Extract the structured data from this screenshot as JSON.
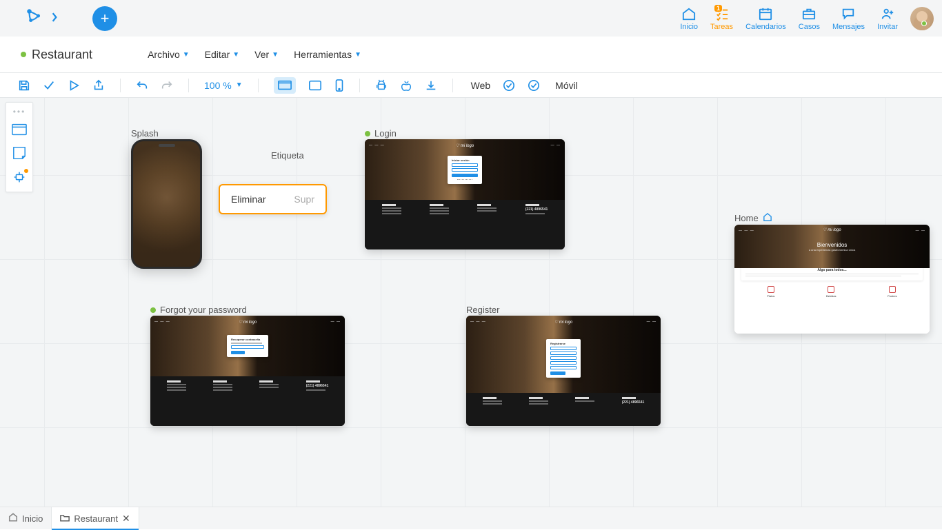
{
  "nav": {
    "inicio": "Inicio",
    "tareas": "Tareas",
    "tareas_badge": "1",
    "calendarios": "Calendarios",
    "casos": "Casos",
    "mensajes": "Mensajes",
    "invitar": "Invitar"
  },
  "doc": {
    "title": "Restaurant"
  },
  "menu": {
    "archivo": "Archivo",
    "editar": "Editar",
    "ver": "Ver",
    "herramientas": "Herramientas"
  },
  "toolbar": {
    "zoom": "100 %",
    "web": "Web",
    "movil": "Móvil"
  },
  "ctx": {
    "label_above": "Etiqueta",
    "eliminar": "Eliminar",
    "supr": "Supr"
  },
  "screens": {
    "splash": "Splash",
    "login": "Login",
    "forgot": "Forgot your password",
    "register": "Register",
    "home": "Home"
  },
  "home_screen": {
    "title": "Bienvenidos",
    "subtitle": "a una experiencia gastronómica única",
    "card_title": "Algo para todos...",
    "platos": "Platos",
    "bebidas": "Bebidas",
    "postres": "Postres"
  },
  "login_screen": {
    "title": "Iniciar sesión"
  },
  "register_screen": {
    "title": "Registrarse"
  },
  "forgot_screen": {
    "title": "Recuperar contraseña"
  },
  "footer": {
    "phone": "(221) 4896541"
  },
  "tabs": {
    "inicio": "Inicio",
    "restaurant": "Restaurant"
  }
}
